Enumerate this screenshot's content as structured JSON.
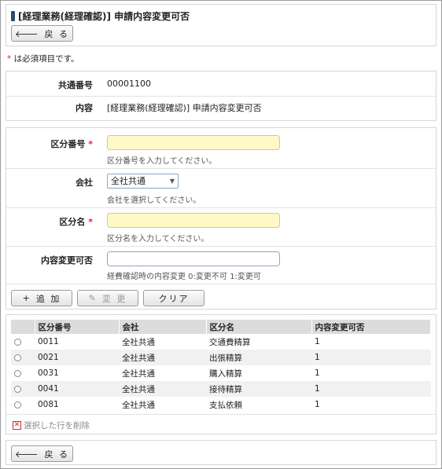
{
  "header": {
    "title": "[経理業務(経理確認)] 申請内容変更可否",
    "back_label": "戻 る"
  },
  "required_note": {
    "mark": "*",
    "text": " は必須項目です。"
  },
  "info": {
    "common_number_label": "共通番号",
    "common_number_value": "00001100",
    "content_label": "内容",
    "content_value": "[経理業務(経理確認)] 申請内容変更可否"
  },
  "form": {
    "category_number": {
      "label": "区分番号",
      "required_mark": "*",
      "value": "",
      "hint": "区分番号を入力してください。"
    },
    "company": {
      "label": "会社",
      "selected": "全社共通",
      "hint": "会社を選択してください。"
    },
    "category_name": {
      "label": "区分名",
      "required_mark": "*",
      "value": "",
      "hint": "区分名を入力してください。"
    },
    "changeable": {
      "label": "内容変更可否",
      "value": "",
      "hint": "経費確認時の内容変更 0:変更不可 1:変更可"
    }
  },
  "actions": {
    "add": "追 加",
    "change": "変 更",
    "clear": "クリア"
  },
  "table": {
    "headers": [
      "区分番号",
      "会社",
      "区分名",
      "内容変更可否"
    ],
    "rows": [
      {
        "num": "0011",
        "company": "全社共通",
        "name": "交通費精算",
        "flag": "1"
      },
      {
        "num": "0021",
        "company": "全社共通",
        "name": "出張精算",
        "flag": "1"
      },
      {
        "num": "0031",
        "company": "全社共通",
        "name": "購入精算",
        "flag": "1"
      },
      {
        "num": "0041",
        "company": "全社共通",
        "name": "接待精算",
        "flag": "1"
      },
      {
        "num": "0081",
        "company": "全社共通",
        "name": "支払依頼",
        "flag": "1"
      }
    ],
    "delete_label": "選択した行を削除"
  },
  "footer": {
    "back_label": "戻 る"
  }
}
